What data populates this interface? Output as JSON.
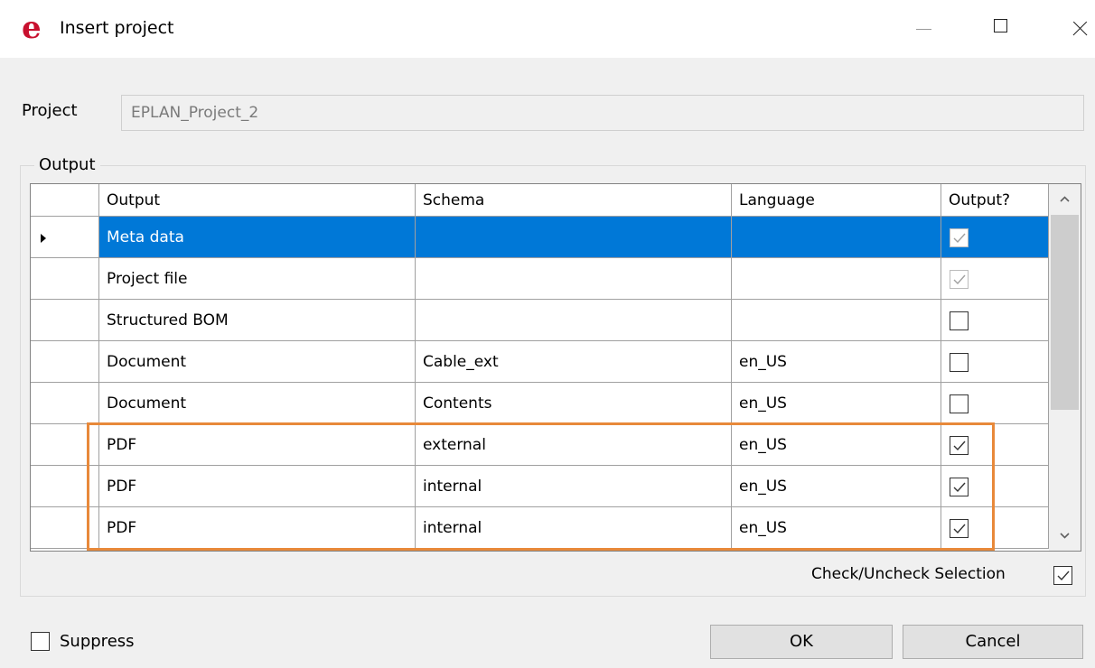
{
  "window": {
    "title": "Insert project",
    "logo": "e"
  },
  "project": {
    "label": "Project",
    "value": "EPLAN_Project_2"
  },
  "output_group": {
    "label": "Output"
  },
  "grid": {
    "columns": [
      "Output",
      "Schema",
      "Language",
      "Output?"
    ],
    "rows": [
      {
        "output": "Meta data",
        "schema": "",
        "language": "",
        "checked": true,
        "disabled": true,
        "selected": true
      },
      {
        "output": "Project file",
        "schema": "",
        "language": "",
        "checked": true,
        "disabled": true,
        "selected": false
      },
      {
        "output": "Structured BOM",
        "schema": "",
        "language": "",
        "checked": false,
        "disabled": false,
        "selected": false
      },
      {
        "output": "Document",
        "schema": "Cable_ext",
        "language": "en_US",
        "checked": false,
        "disabled": false,
        "selected": false
      },
      {
        "output": "Document",
        "schema": "Contents",
        "language": "en_US",
        "checked": false,
        "disabled": false,
        "selected": false
      },
      {
        "output": "PDF",
        "schema": "external",
        "language": "en_US",
        "checked": true,
        "disabled": false,
        "selected": false
      },
      {
        "output": "PDF",
        "schema": "internal",
        "language": "en_US",
        "checked": true,
        "disabled": false,
        "selected": false
      },
      {
        "output": "PDF",
        "schema": "internal",
        "language": "en_US",
        "checked": true,
        "disabled": false,
        "selected": false
      }
    ]
  },
  "check_uncheck": {
    "label": "Check/Uncheck Selection",
    "checked": true
  },
  "suppress": {
    "label": "Suppress",
    "checked": false
  },
  "buttons": {
    "ok": "OK",
    "cancel": "Cancel"
  },
  "colors": {
    "selection": "#0078d7",
    "highlight": "#e8893a",
    "logo": "#c8102e"
  }
}
